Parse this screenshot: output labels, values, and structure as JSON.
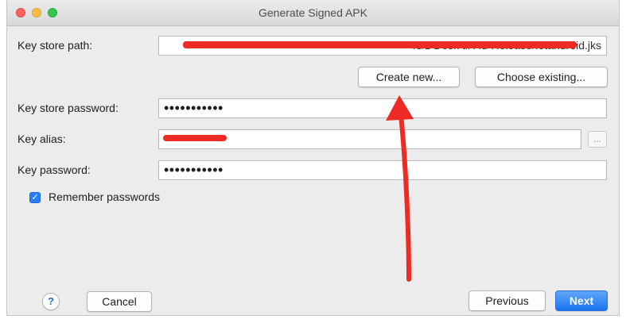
{
  "window": {
    "title": "Generate Signed APK"
  },
  "form": {
    "key_store_path": {
      "label": "Key store path:",
      "value": "rs/z        Desk     tiR             ld-Release/fotandroid.jks"
    },
    "create_new_label": "Create new...",
    "choose_existing_label": "Choose existing...",
    "key_store_password": {
      "label": "Key store password:",
      "value": "•••••••••••"
    },
    "key_alias": {
      "label": "Key alias:",
      "value": "",
      "browse_label": "..."
    },
    "key_password": {
      "label": "Key password:",
      "value": "•••••••••••"
    },
    "remember_passwords": {
      "label": "Remember passwords",
      "checked": true,
      "check_glyph": "✓"
    }
  },
  "footer": {
    "help_label": "?",
    "cancel_label": "Cancel",
    "previous_label": "Previous",
    "next_label": "Next"
  },
  "annotation": {
    "arrow_color": "#ee2a24",
    "redaction_color": "#ee2a24"
  }
}
